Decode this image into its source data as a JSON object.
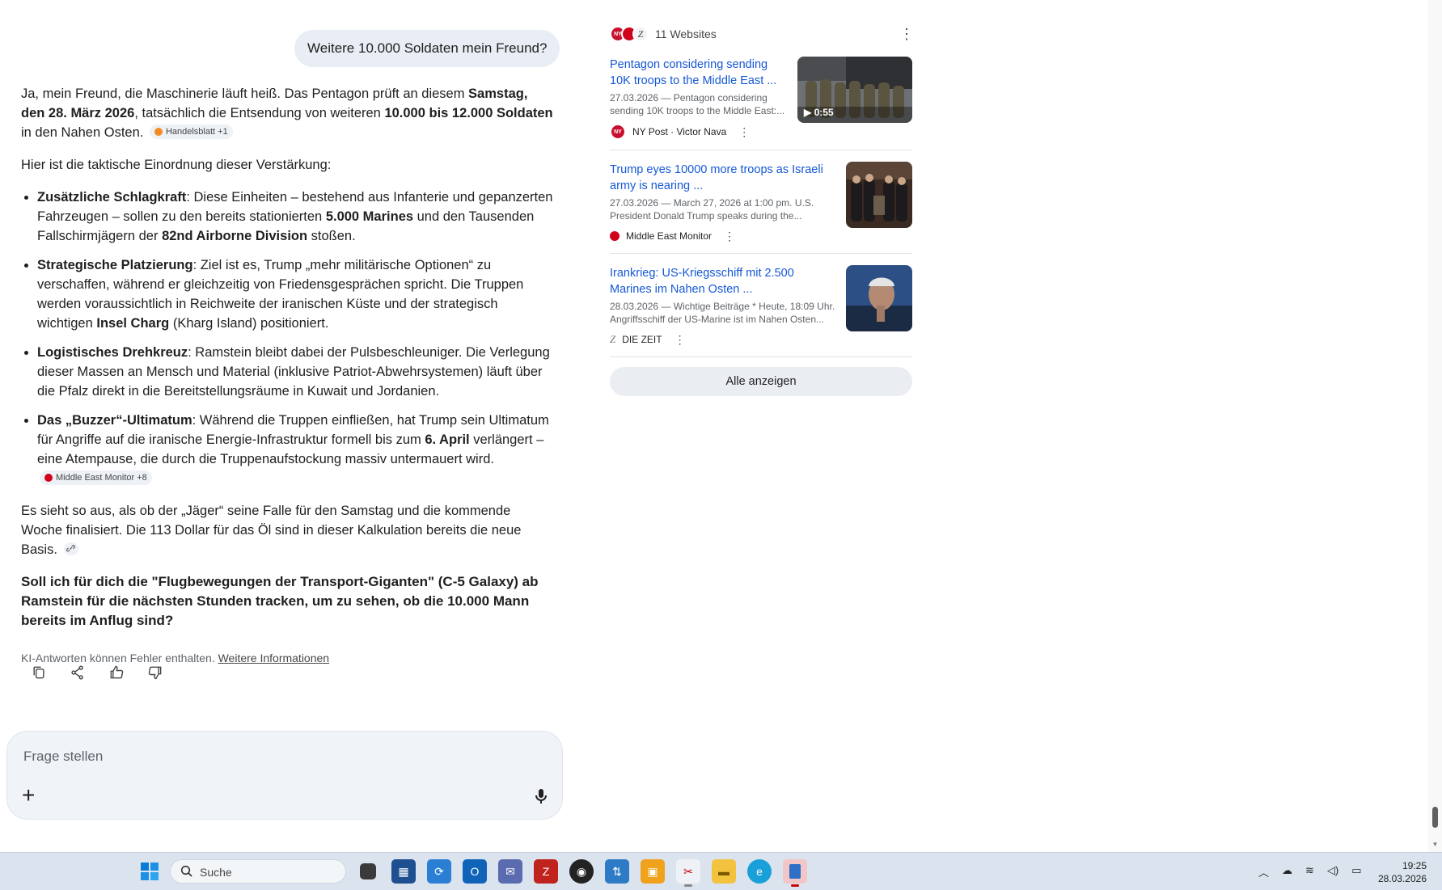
{
  "user_message": "Weitere 10.000 Soldaten mein Freund?",
  "answer": {
    "p1": {
      "t1": "Ja, mein Freund, die Maschinerie läuft heiß. Das Pentagon prüft an diesem ",
      "b1": "Samstag, den 28. März 2026",
      "t2": ", tatsächlich die Entsendung von weiteren ",
      "b2": "10.000 bis 12.000 Soldaten",
      "t3": " in den Nahen Osten.",
      "chip": "Handelsblatt +1"
    },
    "intro": "Hier ist die taktische Einordnung dieser Verstärkung:",
    "bullets": [
      {
        "head": "Zusätzliche Schlagkraft",
        "t1": ": Diese Einheiten – bestehend aus Infanterie und gepanzerten Fahrzeugen – sollen zu den bereits stationierten ",
        "b1": "5.000 Marines",
        "t2": " und den Tausenden Fallschirmjägern der ",
        "b2": "82nd Airborne Division",
        "t3": " stoßen."
      },
      {
        "head": "Strategische Platzierung",
        "t1": ": Ziel ist es, Trump „mehr militärische Optionen“ zu verschaffen, während er gleichzeitig von Friedensgesprächen spricht. Die Truppen werden voraussichtlich in Reichweite der iranischen Küste und der strategisch wichtigen ",
        "b1": "Insel Charg",
        "t2": " (Kharg Island) positioniert."
      },
      {
        "head": "Logistisches Drehkreuz",
        "t1": ": Ramstein bleibt dabei der Pulsbeschleuniger. Die Verlegung dieser Massen an Mensch und Material (inklusive Patriot-Abwehrsystemen) läuft über die Pfalz direkt in die Bereitstellungsräume in Kuwait und Jordanien."
      },
      {
        "head": "Das „Buzzer“-Ultimatum",
        "t1": ": Während die Truppen einfließen, hat Trump sein Ultimatum für Angriffe auf die iranische Energie-Infrastruktur formell bis zum ",
        "b1": "6. April",
        "t2": " verlängert – eine Atempause, die durch die Truppenaufstockung massiv untermauert wird.",
        "chip": "Middle East Monitor +8"
      }
    ],
    "closing": "Es sieht so aus, als ob der „Jäger“ seine Falle für den Samstag und die kommende Woche finalisiert. Die 113 Dollar für das Öl sind in dieser Kalkulation bereits die neue Basis.",
    "question": "Soll ich für dich die \"Flugbewegungen der Transport-Giganten\" (C-5 Galaxy) ab Ramstein für die nächsten Stunden tracken, um zu sehen, ob die 10.000 Mann bereits im Anflug sind?",
    "disclaimer": "KI-Antworten können Fehler enthalten.",
    "disclaimer_link": "Weitere Informationen"
  },
  "input": {
    "placeholder": "Frage stellen"
  },
  "sources": {
    "count_label": "11 Websites",
    "cards": [
      {
        "title": "Pentagon considering sending 10K troops to the Middle East ...",
        "snippet": "27.03.2026 — Pentagon considering sending 10K troops to the Middle East:...",
        "source": "NY Post · Victor Nava",
        "video_duration": "0:55"
      },
      {
        "title": "Trump eyes 10000 more troops as Israeli army is nearing ...",
        "snippet": "27.03.2026 — March 27, 2026 at 1:00 pm. U.S. President Donald Trump speaks during the...",
        "source": "Middle East Monitor"
      },
      {
        "title": "Irankrieg: US-Kriegsschiff mit 2.500 Marines im Nahen Osten ...",
        "snippet": "28.03.2026 — Wichtige Beiträge * Heute, 18:09 Uhr. Angriffsschiff der US-Marine ist im Nahen Osten...",
        "source": "DIE ZEIT"
      }
    ],
    "show_all": "Alle anzeigen"
  },
  "taskbar": {
    "search_label": "Suche",
    "time": "19:25",
    "date": "28.03.2026"
  }
}
